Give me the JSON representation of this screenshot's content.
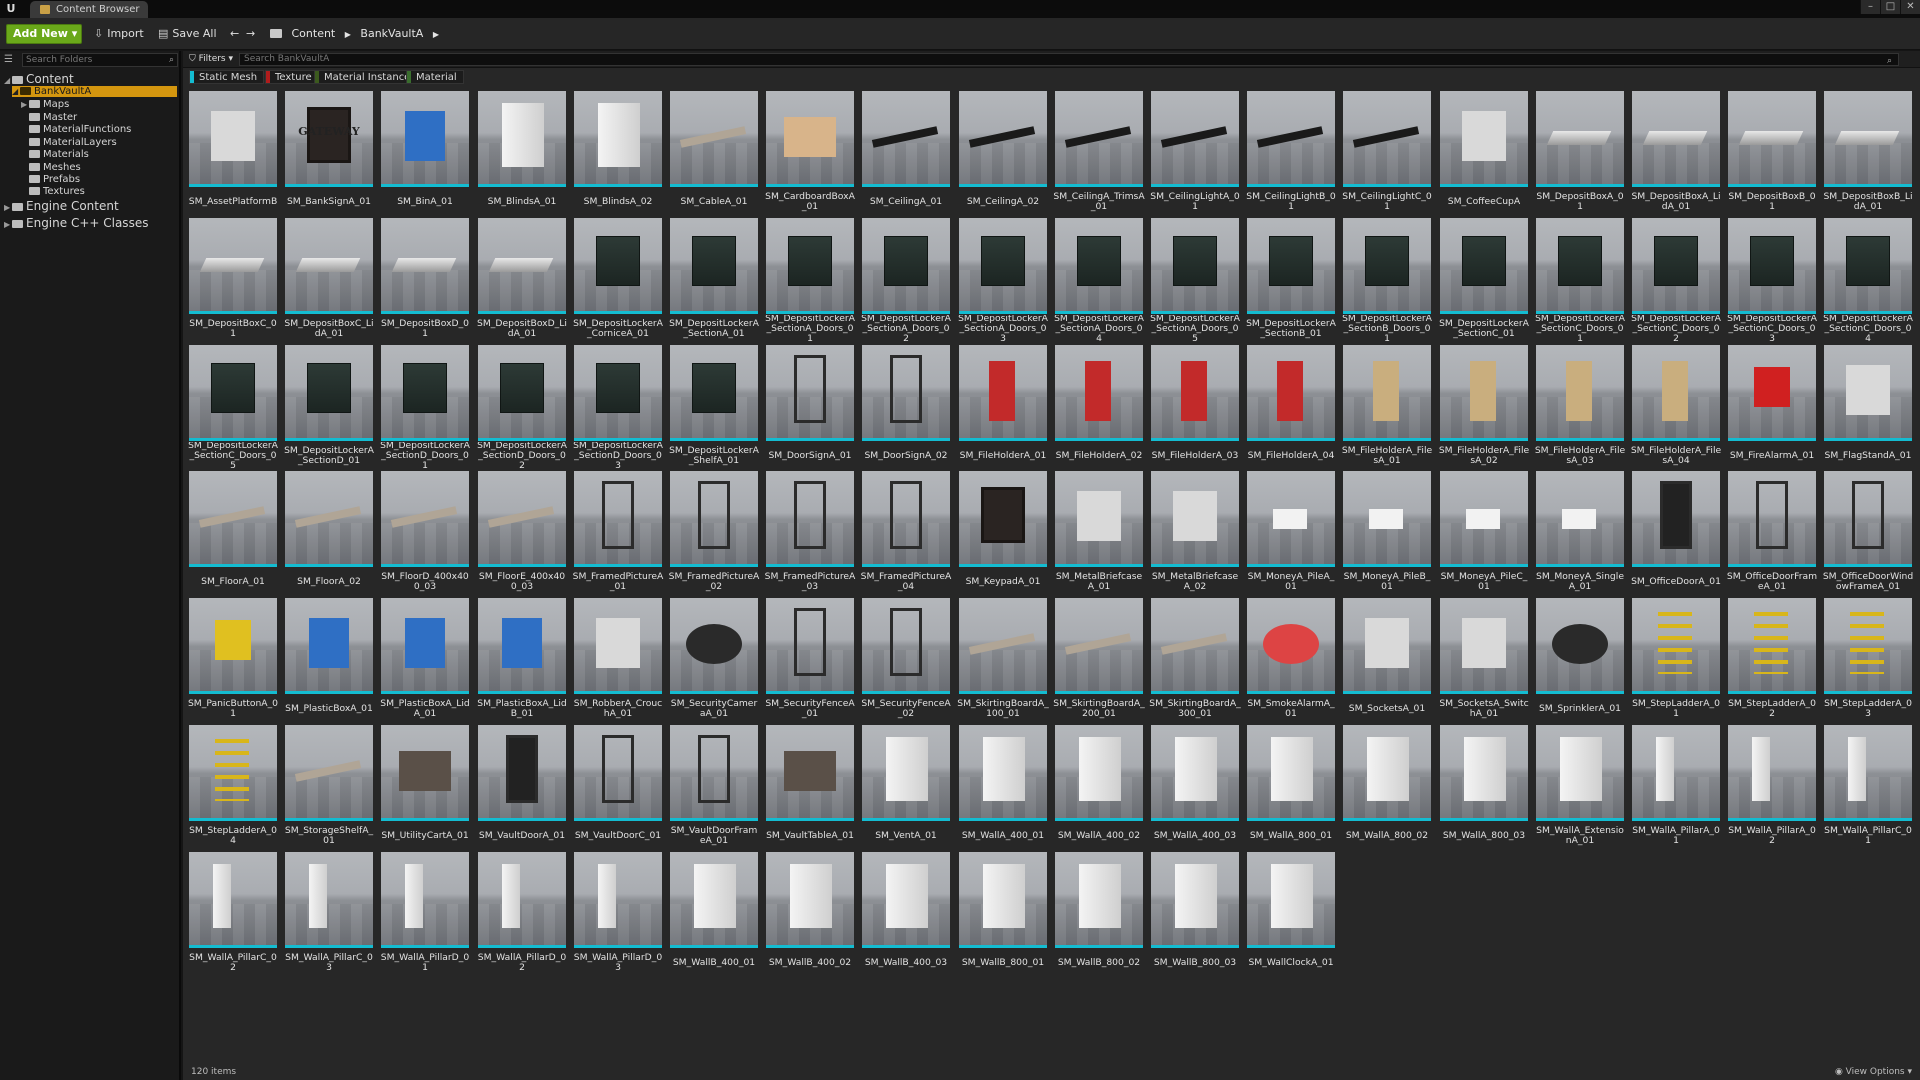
{
  "window": {
    "tab_title": "Content Browser",
    "logo": "U",
    "minimize": "–",
    "maximize": "□",
    "close": "✕"
  },
  "toolbar": {
    "add_new": "Add New ▾",
    "import": "Import",
    "save_all": "Save All",
    "back": "←",
    "forward": "→",
    "breadcrumb": [
      "Content",
      "BankVaultA"
    ],
    "crumb_sep": "▶"
  },
  "tree": {
    "search_placeholder": "Search Folders",
    "root": "Content",
    "selected": "BankVaultA",
    "children": [
      "Maps",
      "Master",
      "MaterialFunctions",
      "MaterialLayers",
      "Materials",
      "Meshes",
      "Prefabs",
      "Textures"
    ],
    "engine_content": "Engine Content",
    "engine_cpp": "Engine C++ Classes"
  },
  "filters": {
    "button": "Filters ▾",
    "search_placeholder": "Search BankVaultA",
    "chips": [
      {
        "label": "Static Mesh",
        "color": "#14bcd1"
      },
      {
        "label": "Texture",
        "color": "#b01c1c"
      },
      {
        "label": "Material Instance",
        "color": "#3c5a1e"
      },
      {
        "label": "Material",
        "color": "#3a6e2e"
      }
    ]
  },
  "assets": [
    "SM_AssetPlatformB",
    "SM_BankSignA_01",
    "SM_BinA_01",
    "SM_BlindsA_01",
    "SM_BlindsA_02",
    "SM_CableA_01",
    "SM_CardboardBoxA_01",
    "SM_CeilingA_01",
    "SM_CeilingA_02",
    "SM_CeilingA_TrimsA_01",
    "SM_CeilingLightA_01",
    "SM_CeilingLightB_01",
    "SM_CeilingLightC_01",
    "SM_CoffeeCupA",
    "SM_DepositBoxA_01",
    "SM_DepositBoxA_LidA_01",
    "SM_DepositBoxB_01",
    "SM_DepositBoxB_LidA_01",
    "SM_DepositBoxC_01",
    "SM_DepositBoxC_LidA_01",
    "SM_DepositBoxD_01",
    "SM_DepositBoxD_LidA_01",
    "SM_DepositLockerA_CorniceA_01",
    "SM_DepositLockerA_SectionA_01",
    "SM_DepositLockerA_SectionA_Doors_01",
    "SM_DepositLockerA_SectionA_Doors_02",
    "SM_DepositLockerA_SectionA_Doors_03",
    "SM_DepositLockerA_SectionA_Doors_04",
    "SM_DepositLockerA_SectionA_Doors_05",
    "SM_DepositLockerA_SectionB_01",
    "SM_DepositLockerA_SectionB_Doors_01",
    "SM_DepositLockerA_SectionC_01",
    "SM_DepositLockerA_SectionC_Doors_01",
    "SM_DepositLockerA_SectionC_Doors_02",
    "SM_DepositLockerA_SectionC_Doors_03",
    "SM_DepositLockerA_SectionC_Doors_04",
    "SM_DepositLockerA_SectionC_Doors_05",
    "SM_DepositLockerA_SectionD_01",
    "SM_DepositLockerA_SectionD_Doors_01",
    "SM_DepositLockerA_SectionD_Doors_02",
    "SM_DepositLockerA_SectionD_Doors_03",
    "SM_DepositLockerA_ShelfA_01",
    "SM_DoorSignA_01",
    "SM_DoorSignA_02",
    "SM_FileHolderA_01",
    "SM_FileHolderA_02",
    "SM_FileHolderA_03",
    "SM_FileHolderA_04",
    "SM_FileHolderA_FilesA_01",
    "SM_FileHolderA_FilesA_02",
    "SM_FileHolderA_FilesA_03",
    "SM_FileHolderA_FilesA_04",
    "SM_FireAlarmA_01",
    "SM_FlagStandA_01",
    "SM_FloorA_01",
    "SM_FloorA_02",
    "SM_FloorD_400x400_03",
    "SM_FloorE_400x400_03",
    "SM_FramedPictureA_01",
    "SM_FramedPictureA_02",
    "SM_FramedPictureA_03",
    "SM_FramedPictureA_04",
    "SM_KeypadA_01",
    "SM_MetalBriefcaseA_01",
    "SM_MetalBriefcaseA_02",
    "SM_MoneyA_PileA_01",
    "SM_MoneyA_PileB_01",
    "SM_MoneyA_PileC_01",
    "SM_MoneyA_SingleA_01",
    "SM_OfficeDoorA_01",
    "SM_OfficeDoorFrameA_01",
    "SM_OfficeDoorWindowFrameA_01",
    "SM_PanicButtonA_01",
    "SM_PlasticBoxA_01",
    "SM_PlasticBoxA_LidA_01",
    "SM_PlasticBoxA_LidB_01",
    "SM_RobberA_CrouchA_01",
    "SM_SecurityCameraA_01",
    "SM_SecurityFenceA_01",
    "SM_SecurityFenceA_02",
    "SM_SkirtingBoardA_100_01",
    "SM_SkirtingBoardA_200_01",
    "SM_SkirtingBoardA_300_01",
    "SM_SmokeAlarmA_01",
    "SM_SocketsA_01",
    "SM_SocketsA_SwitchA_01",
    "SM_SprinklerA_01",
    "SM_StepLadderA_01",
    "SM_StepLadderA_02",
    "SM_StepLadderA_03",
    "SM_StepLadderA_04",
    "SM_StorageShelfA_01",
    "SM_UtilityCartA_01",
    "SM_VaultDoorA_01",
    "SM_VaultDoorC_01",
    "SM_VaultDoorFrameA_01",
    "SM_VaultTableA_01",
    "SM_VentA_01",
    "SM_WallA_400_01",
    "SM_WallA_400_02",
    "SM_WallA_400_03",
    "SM_WallA_800_01",
    "SM_WallA_800_02",
    "SM_WallA_800_03",
    "SM_WallA_ExtensionA_01",
    "SM_WallA_PillarA_01",
    "SM_WallA_PillarA_02",
    "SM_WallA_PillarC_01",
    "SM_WallA_PillarC_02",
    "SM_WallA_PillarC_03",
    "SM_WallA_PillarD_01",
    "SM_WallA_PillarD_02",
    "SM_WallA_PillarD_03",
    "SM_WallB_400_01",
    "SM_WallB_400_02",
    "SM_WallB_400_03",
    "SM_WallB_800_01",
    "SM_WallB_800_02",
    "SM_WallB_800_03",
    "SM_WallClockA_01"
  ],
  "thumb_texts": {
    "SM_BankSignA_01": "GATEWAY"
  },
  "status": {
    "items": "120 items",
    "view_options": "◉ View Options ▾"
  }
}
